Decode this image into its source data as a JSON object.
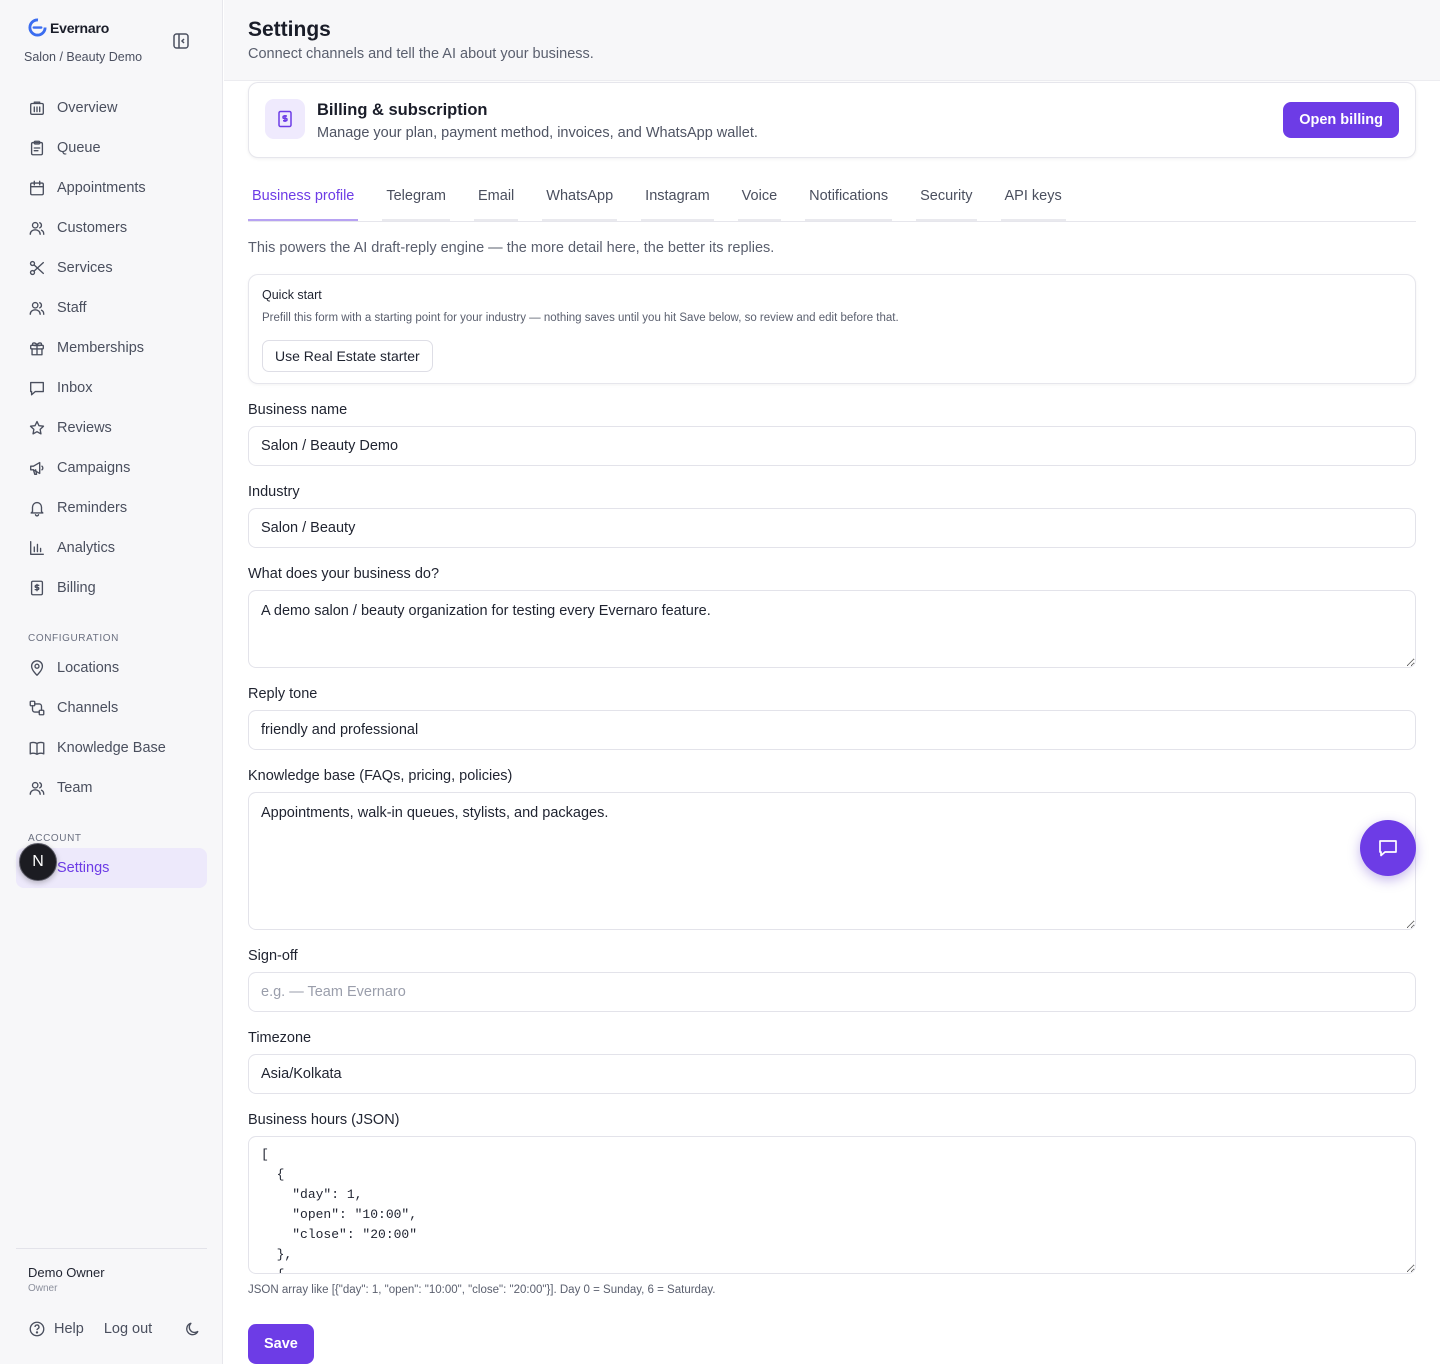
{
  "brand": {
    "name": "Evernaro",
    "org": "Salon / Beauty Demo"
  },
  "nav": {
    "main": [
      {
        "label": "Overview",
        "icon": "building-icon"
      },
      {
        "label": "Queue",
        "icon": "clipboard-icon"
      },
      {
        "label": "Appointments",
        "icon": "calendar-icon"
      },
      {
        "label": "Customers",
        "icon": "users-icon"
      },
      {
        "label": "Services",
        "icon": "scissors-icon"
      },
      {
        "label": "Staff",
        "icon": "users-icon"
      },
      {
        "label": "Memberships",
        "icon": "gift-icon"
      },
      {
        "label": "Inbox",
        "icon": "message-square-icon"
      },
      {
        "label": "Reviews",
        "icon": "star-icon"
      },
      {
        "label": "Campaigns",
        "icon": "megaphone-icon"
      },
      {
        "label": "Reminders",
        "icon": "bell-icon"
      },
      {
        "label": "Analytics",
        "icon": "bar-chart-icon"
      },
      {
        "label": "Billing",
        "icon": "receipt-icon"
      }
    ],
    "configuration_label": "CONFIGURATION",
    "configuration": [
      {
        "label": "Locations",
        "icon": "map-pin-icon"
      },
      {
        "label": "Channels",
        "icon": "workflow-icon"
      },
      {
        "label": "Knowledge Base",
        "icon": "book-open-icon"
      },
      {
        "label": "Team",
        "icon": "users-icon"
      }
    ],
    "account_label": "ACCOUNT",
    "account": [
      {
        "label": "Settings",
        "icon": "settings-icon",
        "active": true
      }
    ]
  },
  "avatar_initial": "N",
  "user": {
    "name": "Demo Owner",
    "role": "Owner"
  },
  "footer": {
    "help": "Help",
    "logout": "Log out"
  },
  "header": {
    "title": "Settings",
    "subtitle": "Connect channels and tell the AI about your business."
  },
  "billing": {
    "title": "Billing & subscription",
    "description": "Manage your plan, payment method, invoices, and WhatsApp wallet.",
    "button": "Open billing"
  },
  "tabs": [
    {
      "label": "Business profile",
      "active": true
    },
    {
      "label": "Telegram"
    },
    {
      "label": "Email"
    },
    {
      "label": "WhatsApp"
    },
    {
      "label": "Instagram"
    },
    {
      "label": "Voice"
    },
    {
      "label": "Notifications"
    },
    {
      "label": "Security"
    },
    {
      "label": "API keys"
    }
  ],
  "helper": "This powers the AI draft-reply engine — the more detail here, the better its replies.",
  "quick_start": {
    "title": "Quick start",
    "description": "Prefill this form with a starting point for your industry — nothing saves until you hit Save below, so review and edit before that.",
    "button": "Use Real Estate starter"
  },
  "form": {
    "business_name": {
      "label": "Business name",
      "value": "Salon / Beauty Demo"
    },
    "industry": {
      "label": "Industry",
      "value": "Salon / Beauty"
    },
    "description": {
      "label": "What does your business do?",
      "value": "A demo salon / beauty organization for testing every Evernaro feature."
    },
    "reply_tone": {
      "label": "Reply tone",
      "value": "friendly and professional"
    },
    "knowledge_base": {
      "label": "Knowledge base (FAQs, pricing, policies)",
      "value": "Appointments, walk-in queues, stylists, and packages."
    },
    "sign_off": {
      "label": "Sign-off",
      "value": "",
      "placeholder": "e.g. — Team Evernaro"
    },
    "timezone": {
      "label": "Timezone",
      "value": "Asia/Kolkata"
    },
    "business_hours": {
      "label": "Business hours (JSON)",
      "value": "[\n  {\n    \"day\": 1,\n    \"open\": \"10:00\",\n    \"close\": \"20:00\"\n  },\n  {",
      "hint": "JSON array like [{\"day\": 1, \"open\": \"10:00\", \"close\": \"20:00\"}]. Day 0 = Sunday, 6 = Saturday."
    }
  },
  "save_label": "Save",
  "colors": {
    "accent": "#6d3ce6",
    "accent_soft": "#ede9fb"
  }
}
